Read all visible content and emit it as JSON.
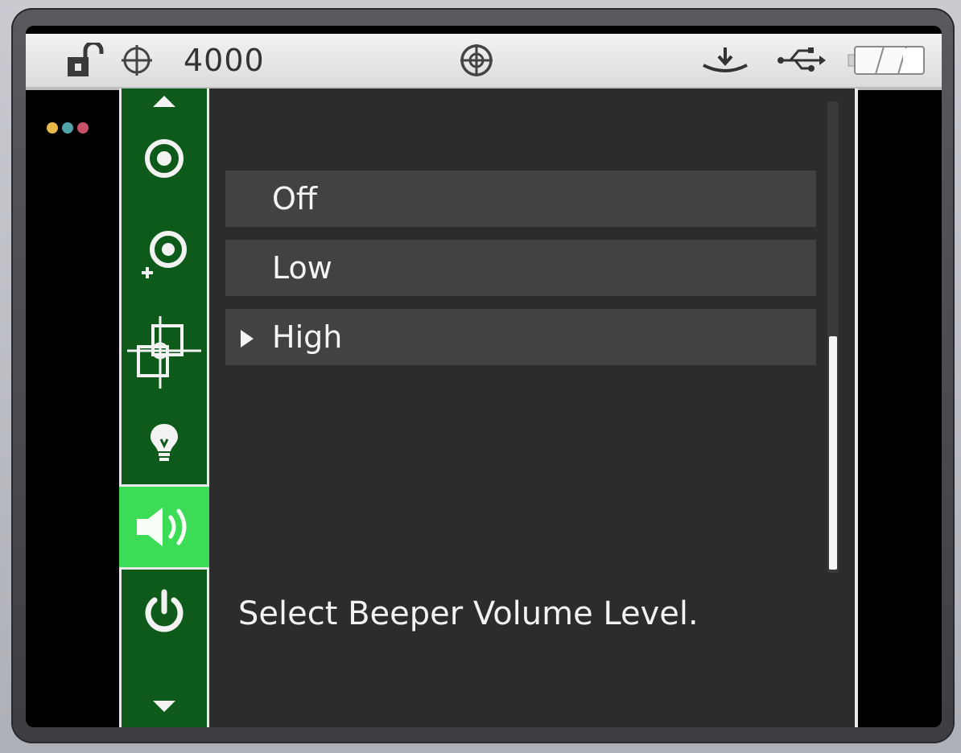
{
  "status_bar": {
    "lock_icon": "unlocked-padlock-icon",
    "target_icon": "crosshair-circle-icon",
    "value": "4000",
    "center_icon": "target-reticle-icon",
    "right_icons": [
      "download-tray-icon",
      "usb-icon",
      "battery-icon"
    ]
  },
  "window_dots": {
    "colors": [
      "#e8b84a",
      "#4fa3a8",
      "#c9506a"
    ]
  },
  "nav": {
    "items": [
      {
        "id": "scroll-up",
        "icon": "triangle-up-icon"
      },
      {
        "id": "target",
        "icon": "target-ring-icon"
      },
      {
        "id": "add-target",
        "icon": "add-target-icon"
      },
      {
        "id": "crosshair",
        "icon": "crosshair-squares-icon"
      },
      {
        "id": "light",
        "icon": "lightbulb-icon"
      },
      {
        "id": "sound",
        "icon": "speaker-icon",
        "active": true
      },
      {
        "id": "power",
        "icon": "power-icon"
      },
      {
        "id": "scroll-down",
        "icon": "triangle-down-icon"
      }
    ],
    "colors": {
      "background": "#0e5a1b",
      "active": "#3ddc57"
    }
  },
  "menu": {
    "options": [
      {
        "label": "Off"
      },
      {
        "label": "Low"
      },
      {
        "label": "High",
        "selected": true
      }
    ],
    "help_text": "Select Beeper Volume Level.",
    "scroll_position": 0.5
  }
}
